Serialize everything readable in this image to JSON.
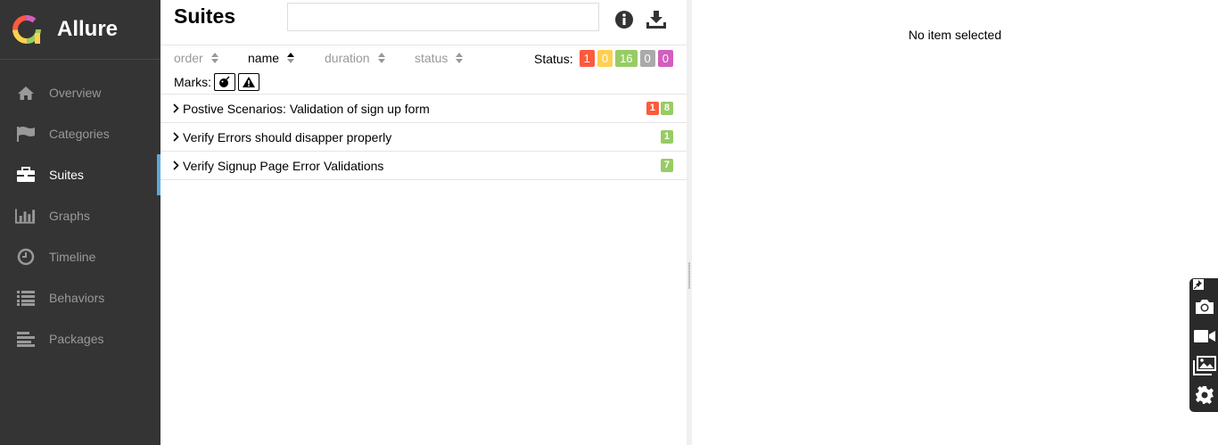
{
  "sidebar": {
    "brand": "Allure",
    "items": [
      {
        "label": "Overview",
        "icon": "home-icon"
      },
      {
        "label": "Categories",
        "icon": "flag-icon"
      },
      {
        "label": "Suites",
        "icon": "briefcase-icon",
        "active": true
      },
      {
        "label": "Graphs",
        "icon": "bar-chart-icon"
      },
      {
        "label": "Timeline",
        "icon": "clock-icon"
      },
      {
        "label": "Behaviors",
        "icon": "list-icon"
      },
      {
        "label": "Packages",
        "icon": "align-left-icon"
      }
    ]
  },
  "suites": {
    "title": "Suites",
    "search_value": "",
    "sort": {
      "order": "order",
      "name": "name",
      "duration": "duration",
      "status": "status"
    },
    "status_label": "Status:",
    "status_counts": [
      {
        "value": "1",
        "color": "#fd5a3e"
      },
      {
        "value": "0",
        "color": "#ffd050"
      },
      {
        "value": "16",
        "color": "#97cc64"
      },
      {
        "value": "0",
        "color": "#aaaaaa"
      },
      {
        "value": "0",
        "color": "#d35ebe"
      }
    ],
    "marks_label": "Marks:",
    "rows": [
      {
        "title": "Postive Scenarios: Validation of sign up form",
        "badges": [
          {
            "value": "1",
            "color": "#fd5a3e"
          },
          {
            "value": "8",
            "color": "#97cc64"
          }
        ]
      },
      {
        "title": "Verify Errors should disapper properly",
        "badges": [
          {
            "value": "1",
            "color": "#97cc64"
          }
        ]
      },
      {
        "title": "Verify Signup Page Error Validations",
        "badges": [
          {
            "value": "7",
            "color": "#97cc64"
          }
        ]
      }
    ]
  },
  "details": {
    "empty_text": "No item selected"
  },
  "colors": {
    "sidebar_bg": "#343434",
    "accent": "#5ca6dc",
    "failed": "#fd5a3e",
    "broken": "#ffd050",
    "passed": "#97cc64",
    "skipped": "#aaaaaa",
    "unknown": "#d35ebe"
  }
}
